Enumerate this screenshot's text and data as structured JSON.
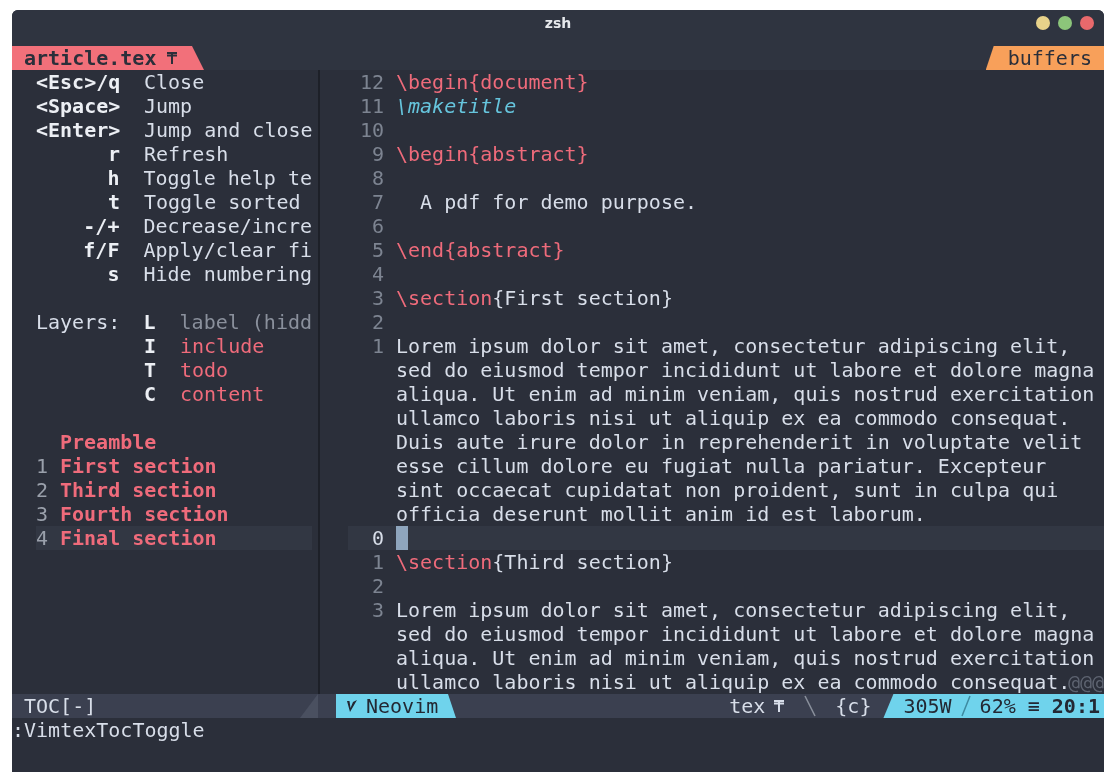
{
  "window": {
    "title": "zsh"
  },
  "tabline": {
    "file_tab": "article.tex",
    "buffers_label": "buffers"
  },
  "toc": {
    "help": [
      {
        "key": "<Esc>/q",
        "action": "Close"
      },
      {
        "key": "<Space>",
        "action": "Jump"
      },
      {
        "key": "<Enter>",
        "action": "Jump and close"
      },
      {
        "key": "r",
        "action": "Refresh"
      },
      {
        "key": "h",
        "action": "Toggle help te"
      },
      {
        "key": "t",
        "action": "Toggle sorted"
      },
      {
        "key": "-/+",
        "action": "Decrease/incre"
      },
      {
        "key": "f/F",
        "action": "Apply/clear fi"
      },
      {
        "key": "s",
        "action": "Hide numbering"
      }
    ],
    "layers_label": "Layers:",
    "layers": [
      {
        "key": "L",
        "name": "label (hidd",
        "enabled": false
      },
      {
        "key": "I",
        "name": "include",
        "enabled": true
      },
      {
        "key": "T",
        "name": "todo",
        "enabled": true
      },
      {
        "key": "C",
        "name": "content",
        "enabled": true
      }
    ],
    "entries": [
      {
        "title": "Preamble",
        "selected": false
      },
      {
        "number": "1",
        "title": "First section",
        "selected": false
      },
      {
        "number": "2",
        "title": "Third section",
        "selected": false
      },
      {
        "number": "3",
        "title": "Fourth section",
        "selected": false
      },
      {
        "number": "4",
        "title": "Final section",
        "selected": true
      }
    ]
  },
  "editor": {
    "lines": [
      {
        "number": "12",
        "current": false,
        "segments": [
          {
            "kind": "command",
            "text": "\\begin{document}"
          }
        ]
      },
      {
        "number": "11",
        "current": false,
        "segments": [
          {
            "kind": "macro",
            "text": "\\maketitle"
          }
        ]
      },
      {
        "number": "10",
        "current": false
      },
      {
        "number": "9",
        "current": false,
        "segments": [
          {
            "kind": "command",
            "text": "\\begin{abstract}"
          }
        ]
      },
      {
        "number": "8",
        "current": false
      },
      {
        "number": "7",
        "current": false,
        "segments": [
          {
            "kind": "text",
            "text": "  A pdf for demo purpose."
          }
        ]
      },
      {
        "number": "6",
        "current": false
      },
      {
        "number": "5",
        "current": false,
        "segments": [
          {
            "kind": "command",
            "text": "\\end{abstract}"
          }
        ]
      },
      {
        "number": "4",
        "current": false
      },
      {
        "number": "3",
        "current": false,
        "segments": [
          {
            "kind": "command",
            "text": "\\section"
          },
          {
            "kind": "text",
            "text": "{First section}"
          }
        ]
      },
      {
        "number": "2",
        "current": false
      },
      {
        "number": "1",
        "current": false,
        "segments": [
          {
            "kind": "text",
            "text": "Lorem ipsum dolor sit amet, consectetur adipiscing elit,"
          }
        ]
      },
      {
        "current": false,
        "segments": [
          {
            "kind": "text",
            "text": "sed do eiusmod tempor incididunt ut labore et dolore magna"
          }
        ]
      },
      {
        "current": false,
        "segments": [
          {
            "kind": "text",
            "text": "aliqua. Ut enim ad minim veniam, quis nostrud exercitation"
          }
        ]
      },
      {
        "current": false,
        "segments": [
          {
            "kind": "text",
            "text": "ullamco laboris nisi ut aliquip ex ea commodo consequat."
          }
        ]
      },
      {
        "current": false,
        "segments": [
          {
            "kind": "text",
            "text": "Duis aute irure dolor in reprehenderit in voluptate velit"
          }
        ]
      },
      {
        "current": false,
        "segments": [
          {
            "kind": "text",
            "text": "esse cillum dolore eu fugiat nulla pariatur. Excepteur"
          }
        ]
      },
      {
        "current": false,
        "segments": [
          {
            "kind": "text",
            "text": "sint occaecat cupidatat non proident, sunt in culpa qui"
          }
        ]
      },
      {
        "current": false,
        "segments": [
          {
            "kind": "text",
            "text": "officia deserunt mollit anim id est laborum."
          }
        ]
      },
      {
        "number": "0",
        "current": true
      },
      {
        "number": "1",
        "current": false,
        "segments": [
          {
            "kind": "command",
            "text": "\\section"
          },
          {
            "kind": "text",
            "text": "{Third section}"
          }
        ]
      },
      {
        "number": "2",
        "current": false
      },
      {
        "number": "3",
        "current": false,
        "segments": [
          {
            "kind": "text",
            "text": "Lorem ipsum dolor sit amet, consectetur adipiscing elit,"
          }
        ]
      },
      {
        "current": false,
        "segments": [
          {
            "kind": "text",
            "text": "sed do eiusmod tempor incididunt ut labore et dolore magna"
          }
        ]
      },
      {
        "current": false,
        "segments": [
          {
            "kind": "text",
            "text": "aliqua. Ut enim ad minim veniam, quis nostrud exercitation"
          }
        ]
      },
      {
        "current": false,
        "segments": [
          {
            "kind": "text",
            "text": "ullamco laboris nisi ut aliquip ex ea commodo consequat."
          }
        ]
      }
    ],
    "overflow_mark": "@@@"
  },
  "status_bar": {
    "pane_label": "TOC[-]",
    "mode": "Neovim",
    "filetype": "tex",
    "scope": "{c}",
    "word_count": "305W",
    "percent": "62%",
    "position_icon": "≡",
    "position": "20:1"
  },
  "command_line": ":VimtexTocToggle"
}
